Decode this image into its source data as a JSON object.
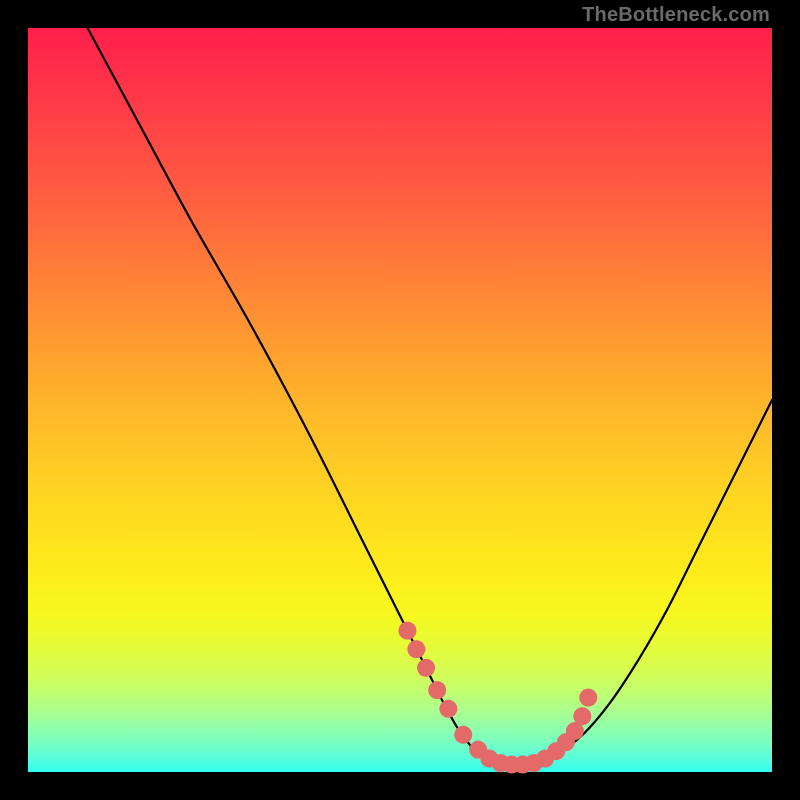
{
  "watermark": "TheBottleneck.com",
  "chart_data": {
    "type": "line",
    "title": "",
    "xlabel": "",
    "ylabel": "",
    "xlim": [
      0,
      100
    ],
    "ylim": [
      0,
      100
    ],
    "grid": false,
    "legend": false,
    "series": [
      {
        "name": "bottleneck-curve",
        "color": "#000000",
        "x": [
          8,
          15,
          22,
          30,
          38,
          45,
          50,
          53.5,
          56,
          58,
          60,
          62,
          64,
          66,
          68,
          70,
          74,
          78,
          82,
          86,
          90,
          94,
          98,
          100
        ],
        "y": [
          100,
          87,
          74,
          60,
          45,
          31,
          21,
          14,
          9,
          5.5,
          3,
          1.5,
          1,
          1,
          1.3,
          2,
          4.5,
          9,
          15,
          22,
          30,
          38,
          46,
          50
        ]
      },
      {
        "name": "highlighted-dots",
        "color": "#e46a6a",
        "type": "scatter",
        "x": [
          51,
          52.2,
          53.5,
          55,
          56.5,
          58.5,
          60.5,
          62,
          63.5,
          65,
          66.5,
          68,
          69.5,
          71,
          72.3,
          73.5,
          74.5,
          75.3
        ],
        "y": [
          19,
          16.5,
          14,
          11,
          8.5,
          5,
          3,
          1.8,
          1.2,
          1,
          1,
          1.2,
          1.8,
          2.8,
          4,
          5.5,
          7.5,
          10
        ]
      }
    ],
    "background_gradient": {
      "top": "#ff1f4b",
      "mid": "#ffe11e",
      "bottom": "#2efcef"
    }
  }
}
